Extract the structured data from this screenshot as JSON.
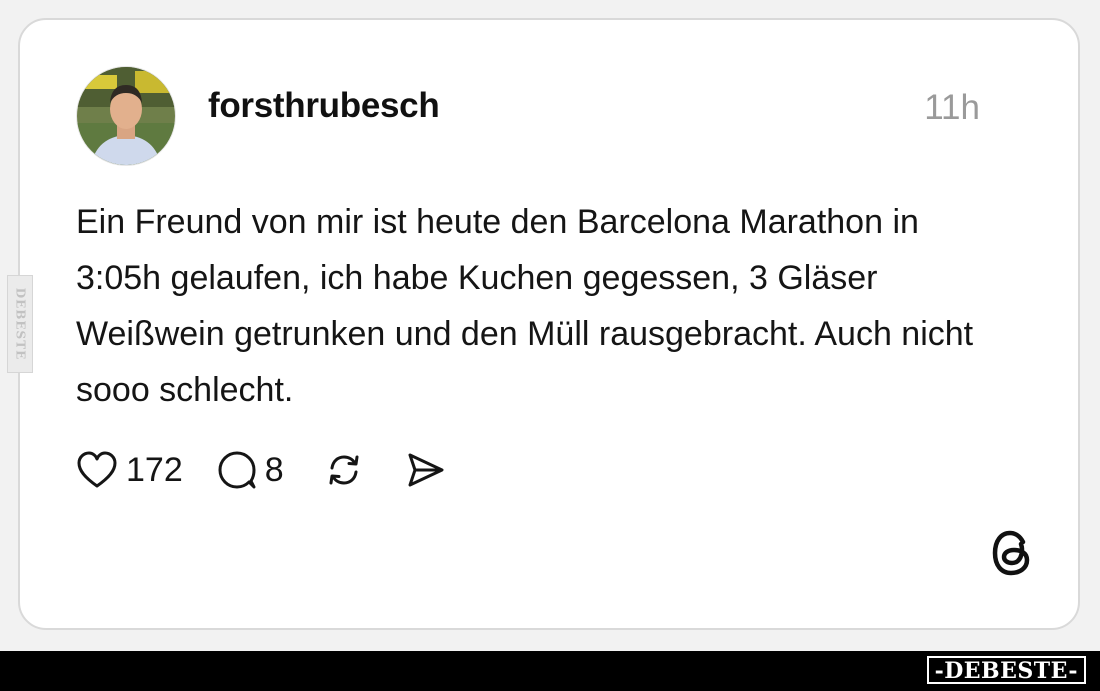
{
  "post": {
    "username": "forsthrubesch",
    "time": "11h",
    "text": "Ein Freund von mir ist heute den Barcelona Marathon in 3:05h gelaufen, ich habe Kuchen gegessen, 3 Gläser Weißwein getrunken und den Müll rausgebracht. Auch nicht sooo schlecht.",
    "likes": "172",
    "replies": "8"
  },
  "icons": {
    "like": "heart-icon",
    "reply": "speech-bubble-icon",
    "repost": "repost-icon",
    "share": "send-icon",
    "app": "threads-logo-icon"
  },
  "watermark": {
    "side": "DEBESTE",
    "brand": "-DEBESTE-"
  },
  "colors": {
    "background": "#f2f2f2",
    "card": "#ffffff",
    "text": "#151515",
    "muted": "#9a9a9a",
    "bar": "#000000"
  }
}
